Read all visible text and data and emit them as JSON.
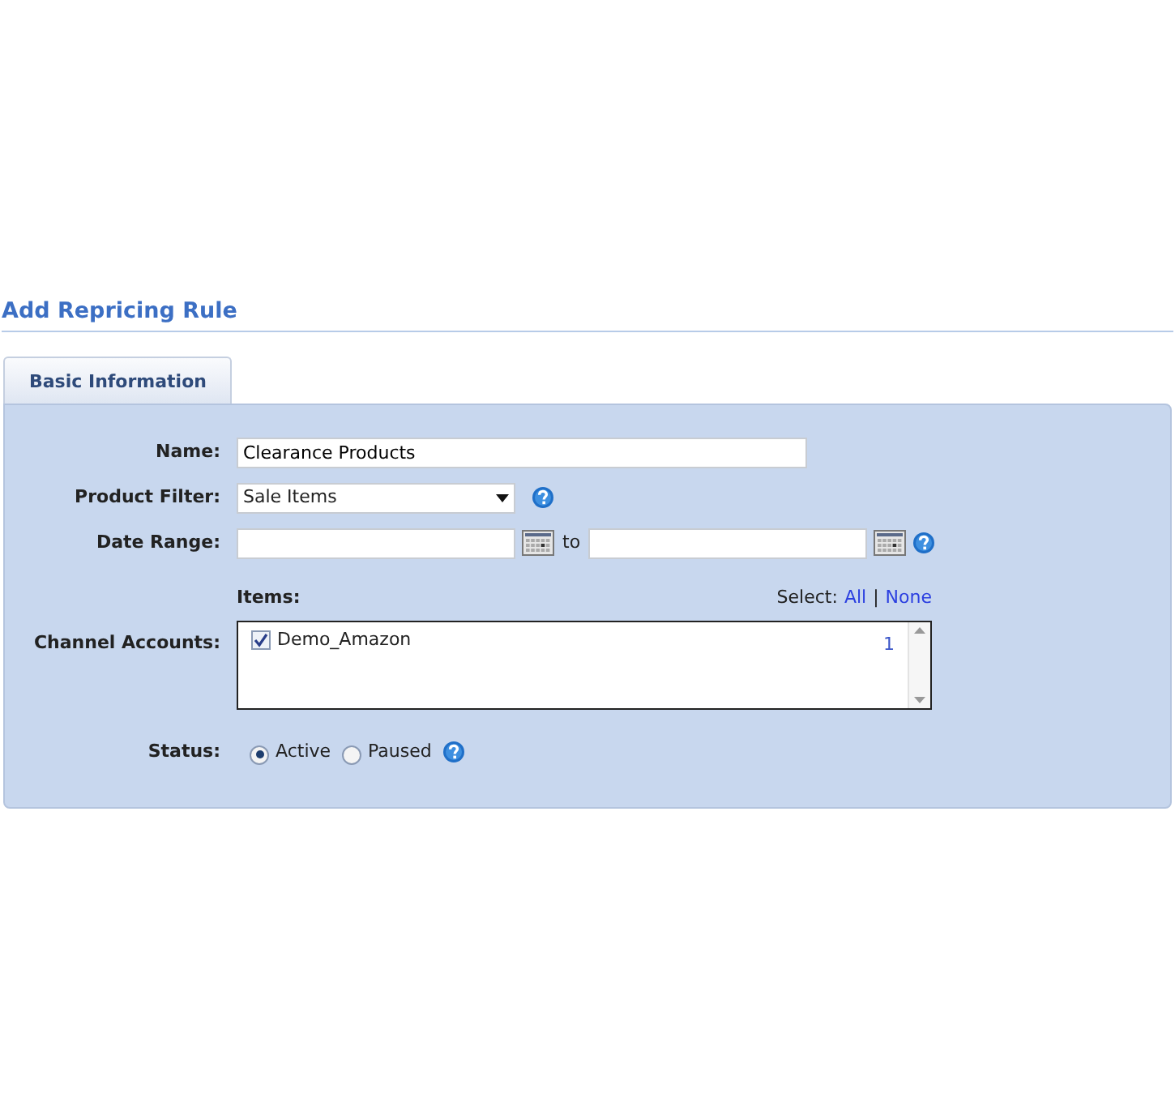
{
  "title": "Add Repricing Rule",
  "tabs": [
    {
      "label": "Basic Information",
      "selected": true
    }
  ],
  "form": {
    "name": {
      "label": "Name:",
      "value": "Clearance Products"
    },
    "product_filter": {
      "label": "Product Filter:",
      "value": "Sale Items"
    },
    "date_range": {
      "label": "Date Range:",
      "separator": "to"
    },
    "items": {
      "label": "Items:",
      "select_label": "Select:",
      "select_all": "All",
      "divider": "|",
      "select_none": "None"
    },
    "channel_accounts": {
      "label": "Channel Accounts:",
      "options": [
        {
          "label": "Demo_Amazon",
          "checked": true,
          "count": "1"
        }
      ]
    },
    "status": {
      "label": "Status:",
      "options": [
        {
          "label": "Active",
          "selected": true
        },
        {
          "label": "Paused",
          "selected": false
        }
      ]
    }
  }
}
